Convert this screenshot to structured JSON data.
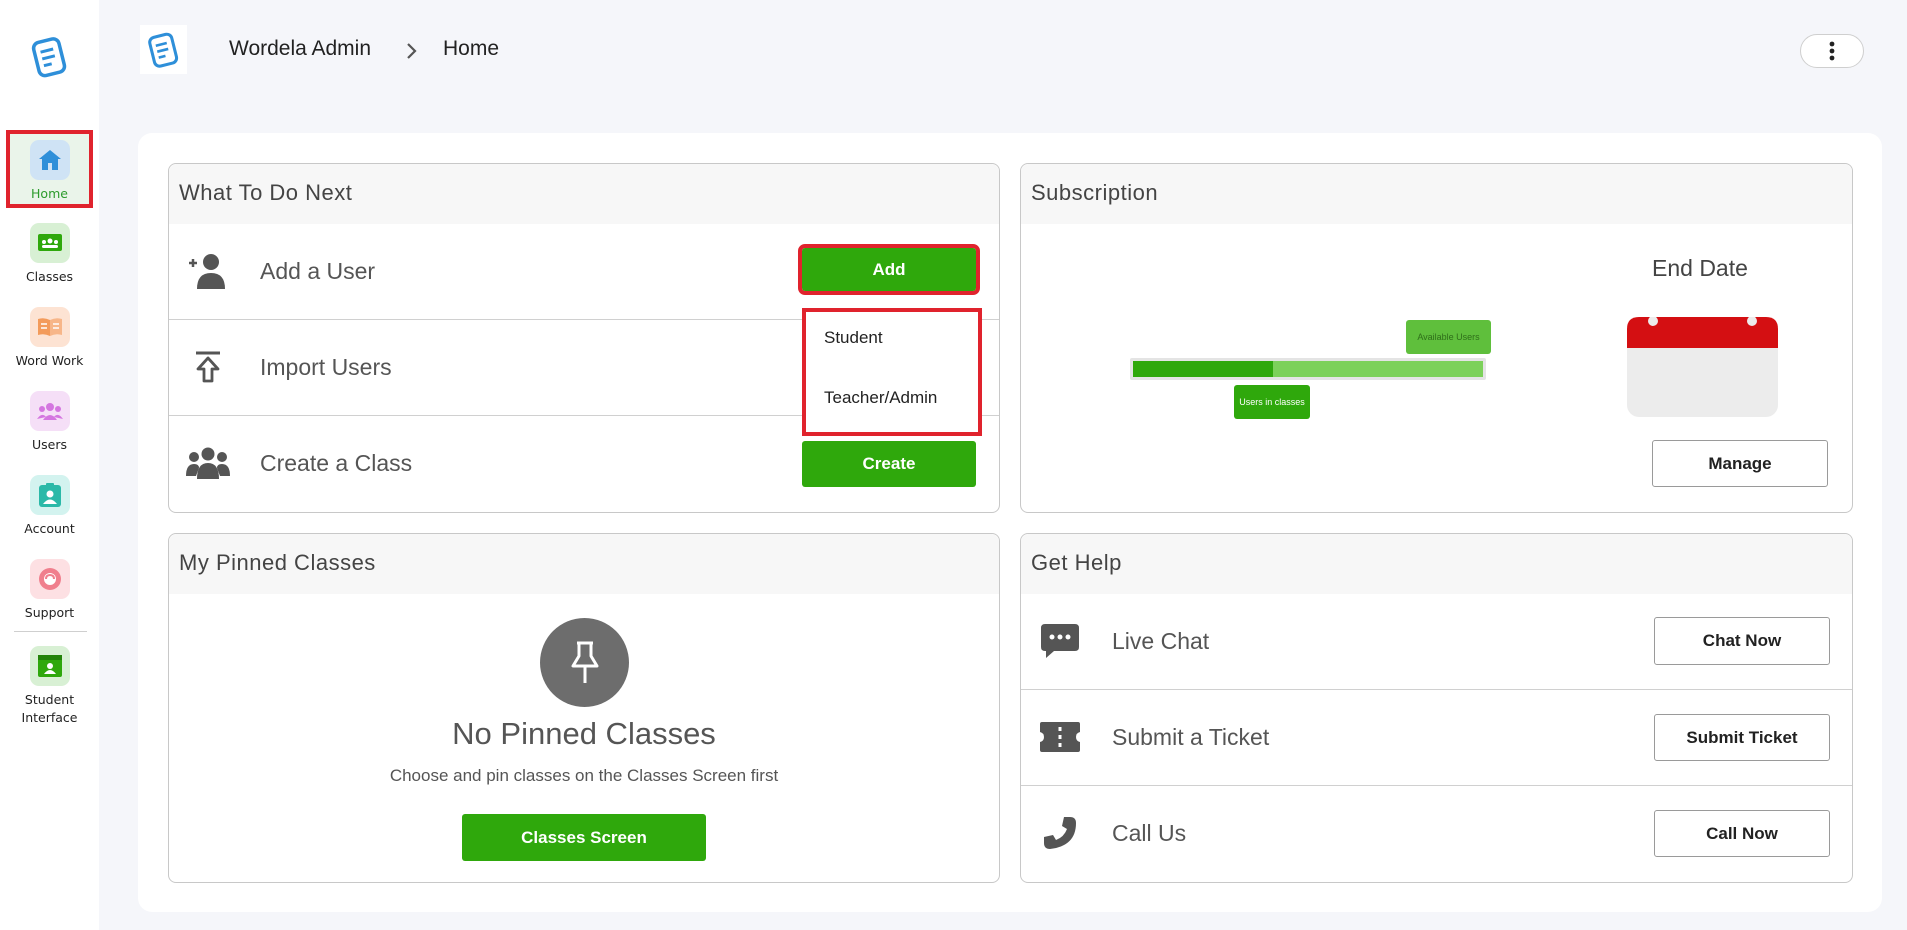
{
  "app": {
    "title": "Wordela Admin",
    "page": "Home"
  },
  "sidebar": {
    "items": [
      {
        "label": "Home",
        "icon": "home-icon",
        "active": true
      },
      {
        "label": "Classes",
        "icon": "classes-icon"
      },
      {
        "label": "Word Work",
        "icon": "book-icon"
      },
      {
        "label": "Users",
        "icon": "users-icon"
      },
      {
        "label": "Account",
        "icon": "account-icon"
      },
      {
        "label": "Support",
        "icon": "support-icon"
      },
      {
        "label": "Student Interface",
        "icon": "student-interface-icon"
      }
    ]
  },
  "todo": {
    "title": "What To Do Next",
    "rows": [
      {
        "label": "Add a User",
        "button": "Add"
      },
      {
        "label": "Import Users",
        "button": ""
      },
      {
        "label": "Create a Class",
        "button": "Create"
      }
    ],
    "add_menu": [
      "Student",
      "Teacher/Admin"
    ]
  },
  "subscription": {
    "title": "Subscription",
    "end_date_label": "End Date",
    "available_label": "Available Users",
    "in_classes_label": "Users in classes",
    "users_in_classes_fraction": 0.4,
    "manage_button": "Manage"
  },
  "pinned": {
    "title": "My Pinned Classes",
    "empty_title": "No Pinned Classes",
    "empty_text": "Choose and pin classes on the Classes Screen first",
    "button": "Classes Screen"
  },
  "help": {
    "title": "Get Help",
    "rows": [
      {
        "label": "Live Chat",
        "button": "Chat Now"
      },
      {
        "label": "Submit a Ticket",
        "button": "Submit Ticket"
      },
      {
        "label": "Call Us",
        "button": "Call Now"
      }
    ]
  },
  "colors": {
    "accent_green": "#2fa80c",
    "highlight_red": "#e0232d",
    "calendar_red": "#d40f12"
  }
}
